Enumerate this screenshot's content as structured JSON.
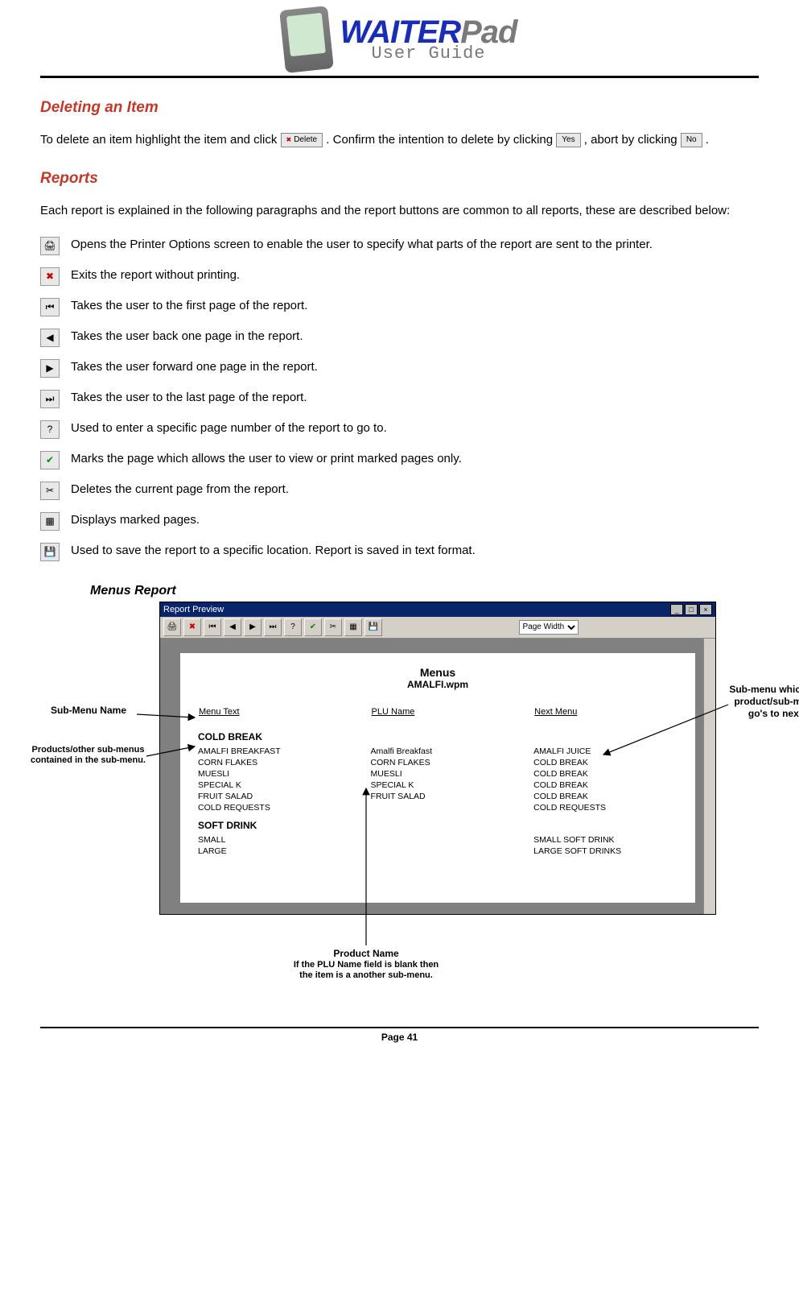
{
  "header": {
    "brand_part1": "WAITER",
    "brand_part2": "Pad",
    "subtitle": "User Guide"
  },
  "section1": {
    "title": "Deleting an Item",
    "text_part1": "To delete an item highlight the item and click ",
    "btn_delete": "Delete",
    "text_part2": ". Confirm the intention to delete by clicking ",
    "btn_yes": "Yes",
    "text_part3": ", abort by clicking ",
    "btn_no": "No",
    "text_part4": "."
  },
  "section2": {
    "title": "Reports",
    "intro": "Each report is explained in the following paragraphs and the report buttons are common to all reports, these are described below:"
  },
  "icons": [
    {
      "glyph": "🖨",
      "name": "print-icon",
      "desc": "Opens the Printer Options screen to enable the user to specify what parts of the report are sent to the printer."
    },
    {
      "glyph": "✖",
      "name": "close-icon",
      "desc": "Exits the report without printing.",
      "color": "#c00"
    },
    {
      "glyph": "⏮",
      "name": "first-page-icon",
      "desc": "Takes the user to the first page of the report."
    },
    {
      "glyph": "◀",
      "name": "prev-page-icon",
      "desc": "Takes the user back one page in the report."
    },
    {
      "glyph": "▶",
      "name": "next-page-icon",
      "desc": "Takes the user forward one page in the report."
    },
    {
      "glyph": "⏭",
      "name": "last-page-icon",
      "desc": "Takes the user to the last page of the report."
    },
    {
      "glyph": "?",
      "name": "goto-page-icon",
      "desc": "Used to enter a specific page number of the report to go to."
    },
    {
      "glyph": "✔",
      "name": "mark-page-icon",
      "desc": "Marks the page which allows the user to view or print marked pages only.",
      "color": "#080"
    },
    {
      "glyph": "✂",
      "name": "delete-page-icon",
      "desc": "Deletes the current page from the report."
    },
    {
      "glyph": "▦",
      "name": "show-marked-icon",
      "desc": "Displays marked pages."
    },
    {
      "glyph": "💾",
      "name": "save-icon",
      "desc": "Used to save the report to a specific location. Report is saved in text format."
    }
  ],
  "subsection": {
    "title": "Menus Report"
  },
  "report": {
    "window_title": "Report Preview",
    "zoom_option": "Page Width",
    "title": "Menus",
    "file": "AMALFI.wpm",
    "columns": [
      "Menu Text",
      "PLU Name",
      "Next Menu"
    ],
    "groups": [
      {
        "name": "COLD BREAK",
        "rows": [
          [
            "AMALFI BREAKFAST",
            "Amalfi Breakfast",
            "AMALFI JUICE"
          ],
          [
            "CORN FLAKES",
            "CORN FLAKES",
            "COLD BREAK"
          ],
          [
            "MUESLI",
            "MUESLI",
            "COLD BREAK"
          ],
          [
            "SPECIAL K",
            "SPECIAL K",
            "COLD BREAK"
          ],
          [
            "FRUIT SALAD",
            "FRUIT SALAD",
            "COLD BREAK"
          ],
          [
            "COLD REQUESTS",
            "",
            "COLD REQUESTS"
          ]
        ]
      },
      {
        "name": "SOFT DRINK",
        "rows": [
          [
            "SMALL",
            "",
            "SMALL SOFT DRINK"
          ],
          [
            "LARGE",
            "",
            "LARGE SOFT DRINKS"
          ]
        ]
      }
    ]
  },
  "callouts": {
    "submenu_name": "Sub-Menu Name",
    "products_in_submenu": "Products/other sub-menus contained in the sub-menu.",
    "product_name_title": "Product Name",
    "product_name_body": "If the PLU Name field is blank then the item is a another sub-menu.",
    "next_submenu": "Sub-menu which the product/sub-menu go's to next."
  },
  "footer": {
    "page_label": "Page 41"
  }
}
